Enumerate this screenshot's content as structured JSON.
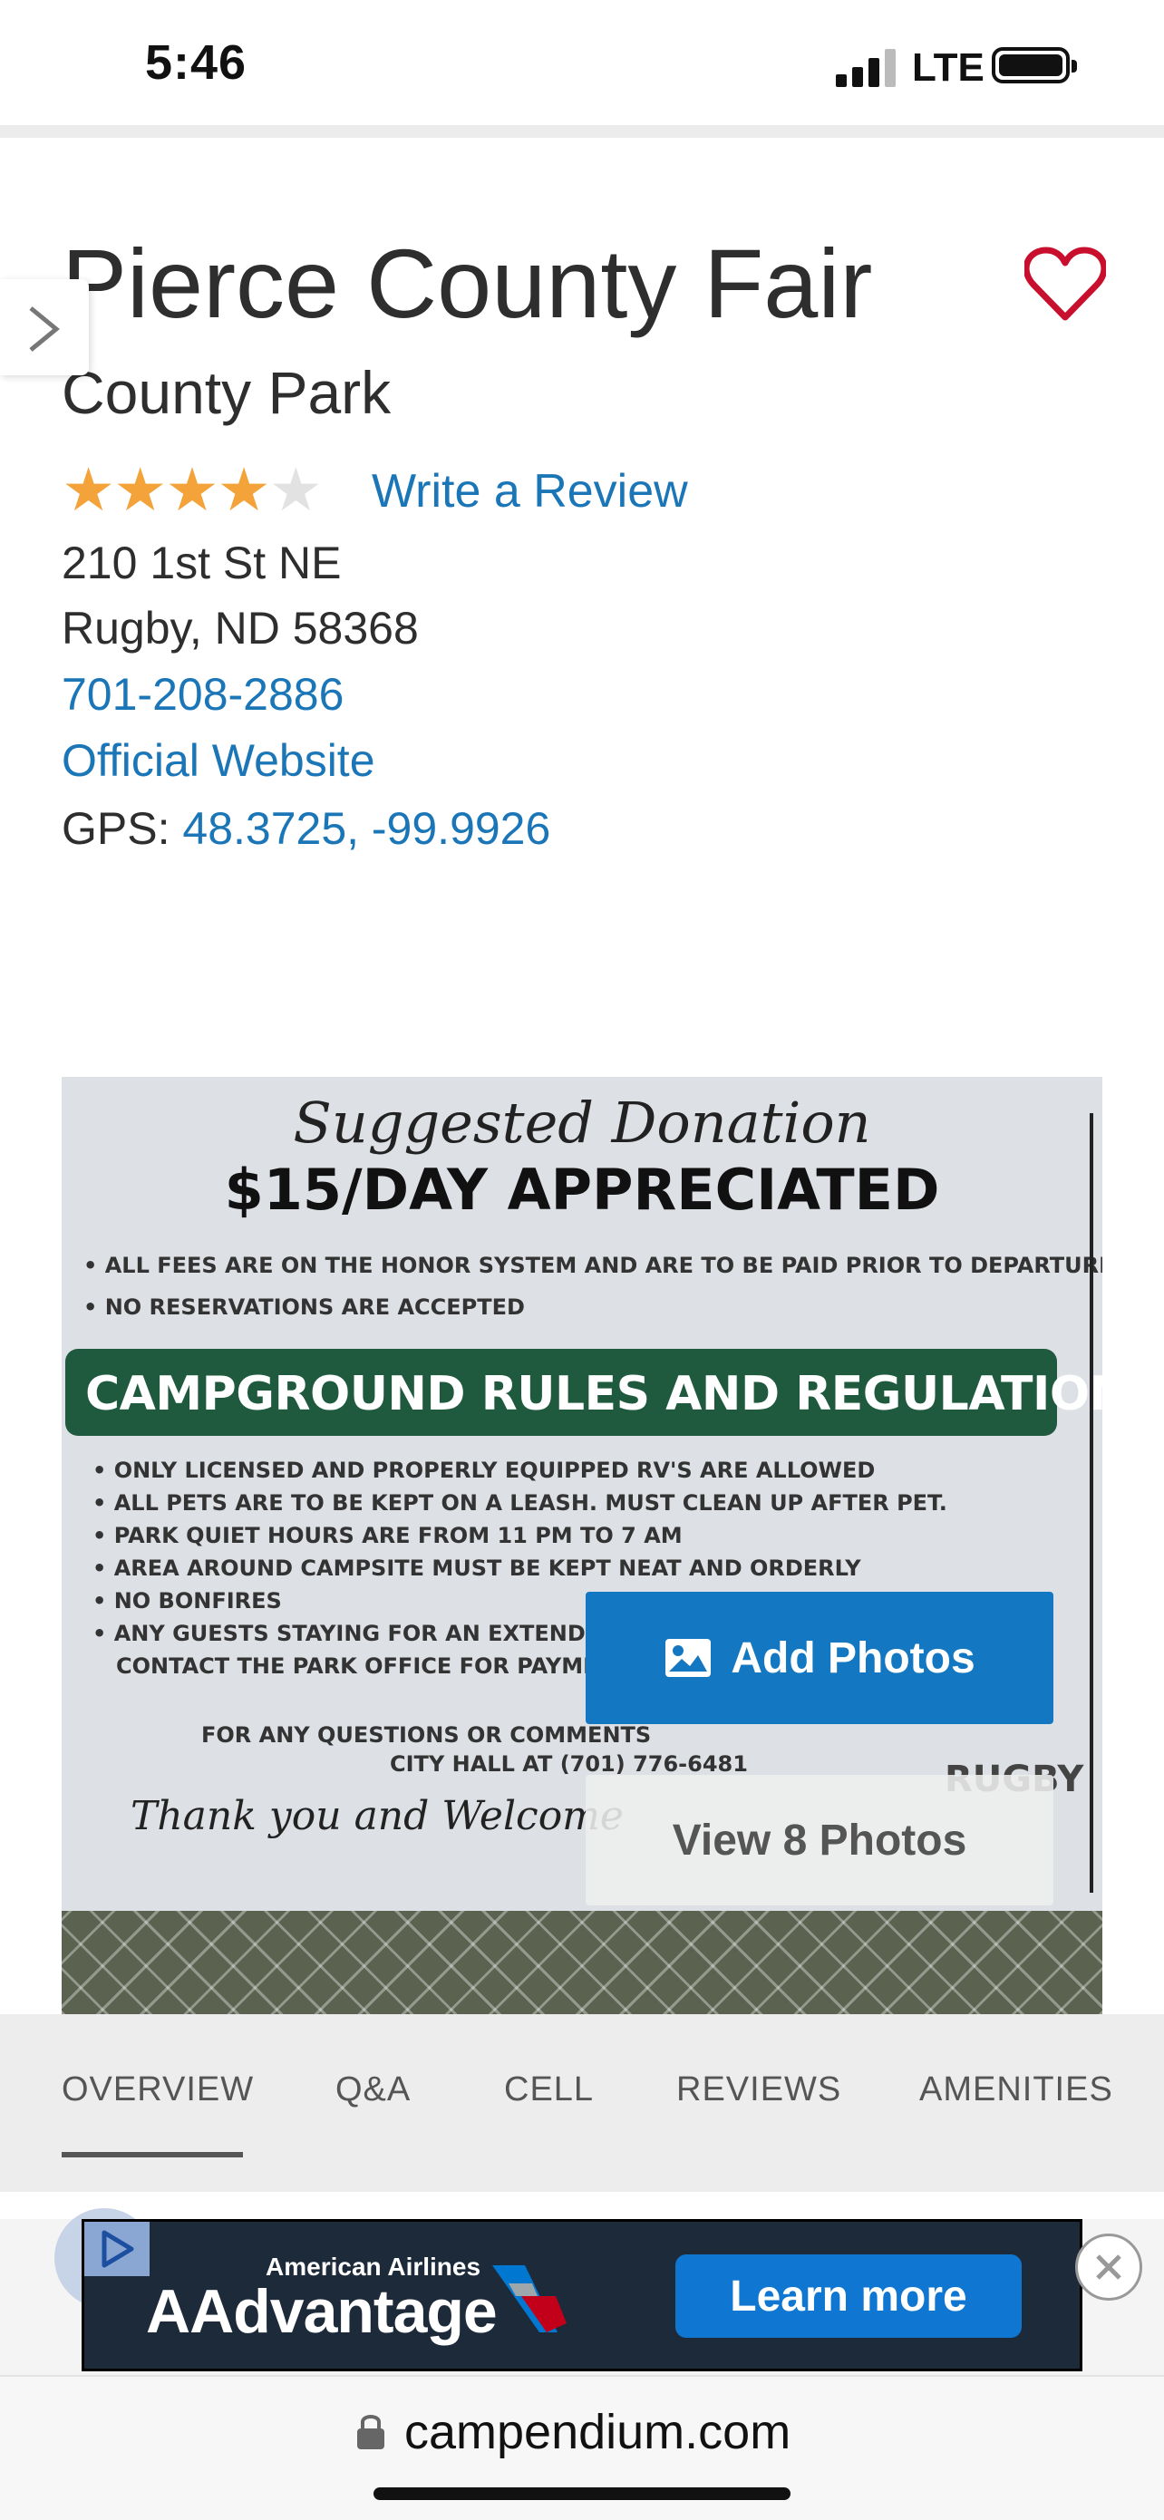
{
  "status_bar": {
    "time": "5:46",
    "network": "LTE"
  },
  "park": {
    "title": "Pierce County Fair",
    "subtitle": "County Park",
    "rating": 4,
    "rating_max": 5,
    "write_review": "Write a Review",
    "address_line1": "210 1st St NE",
    "address_line2": "Rugby, ND 58368",
    "phone": "701-208-2886",
    "website": "Official Website",
    "gps_label": "GPS:",
    "gps_value": "48.3725, -99.9926"
  },
  "photo": {
    "sign_donation": "Suggested Donation",
    "sign_price": "$15/DAY APPRECIATED",
    "sign_note1": "• ALL FEES ARE ON THE HONOR SYSTEM AND ARE TO BE PAID PRIOR TO DEPARTURE",
    "sign_note2": "• NO RESERVATIONS ARE ACCEPTED",
    "sign_banner": "CAMPGROUND RULES AND REGULATIONS",
    "sign_rule1": "• ONLY LICENSED AND PROPERLY EQUIPPED RV'S ARE ALLOWED",
    "sign_rule2": "• ALL PETS ARE TO BE KEPT ON A LEASH. MUST CLEAN UP AFTER PET.",
    "sign_rule3": "• PARK QUIET HOURS ARE FROM 11 PM TO 7 AM",
    "sign_rule4": "• AREA AROUND CAMPSITE MUST BE KEPT NEAT AND ORDERLY",
    "sign_rule5": "• NO BONFIRES",
    "sign_rule6": "• ANY GUESTS STAYING FOR AN EXTENDE",
    "sign_rule7": "CONTACT THE PARK OFFICE FOR PAYME",
    "sign_contact1": "FOR ANY QUESTIONS OR COMMENTS",
    "sign_contact2": "CITY HALL AT (701) 776-6481",
    "sign_thanks": "Thank you and Welcome",
    "sign_logo": "RUGBY",
    "add_photos": "Add Photos",
    "view_photos": "View 8 Photos"
  },
  "tabs": [
    "OVERVIEW",
    "Q&A",
    "CELL",
    "REVIEWS",
    "AMENITIES"
  ],
  "active_tab": "OVERVIEW",
  "ad": {
    "brand_small": "American Airlines",
    "brand_big": "AAdvantage",
    "cta": "Learn more"
  },
  "browser": {
    "url": "campendium.com"
  },
  "colors": {
    "link": "#1b76b8",
    "star": "#f3a33a",
    "heart": "#c8102e",
    "primary_button": "#1477c2"
  },
  "icons": [
    "heart-icon",
    "chevron-right-icon",
    "image-icon",
    "lock-icon",
    "close-icon",
    "adchoices-icon"
  ]
}
